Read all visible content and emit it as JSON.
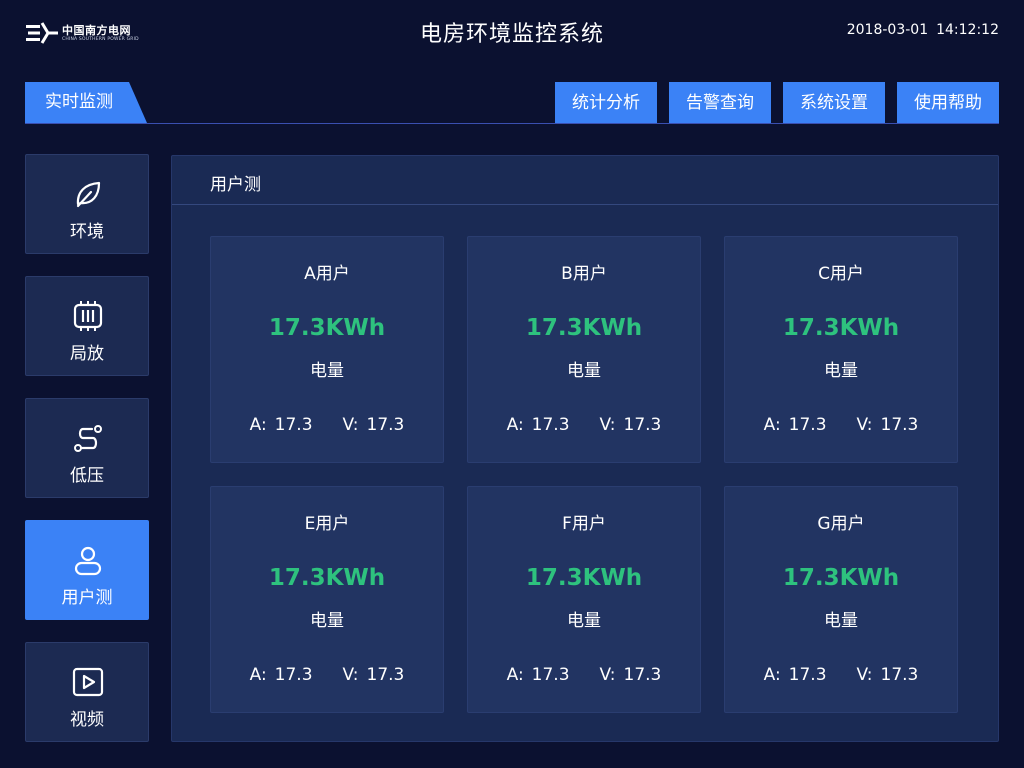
{
  "header": {
    "logo_cn": "中国南方电网",
    "logo_en": "CHINA SOUTHERN POWER GRID",
    "title": "电房环境监控系统",
    "date": "2018-03-01",
    "time": "14:12:12"
  },
  "nav": {
    "active_tab": "实时监测",
    "buttons": [
      "统计分析",
      "告警查询",
      "系统设置",
      "使用帮助"
    ]
  },
  "sidebar": {
    "items": [
      {
        "label": "环境",
        "icon": "leaf-icon",
        "active": false
      },
      {
        "label": "局放",
        "icon": "chip-icon",
        "active": false
      },
      {
        "label": "低压",
        "icon": "route-icon",
        "active": false
      },
      {
        "label": "用户测",
        "icon": "user-icon",
        "active": true
      },
      {
        "label": "视频",
        "icon": "play-icon",
        "active": false
      }
    ]
  },
  "panel": {
    "title": "用户测",
    "cards": [
      {
        "name": "A用户",
        "value": "17.3KWh",
        "value_label": "电量",
        "a_key": "A:",
        "a_val": "17.3",
        "v_key": "V:",
        "v_val": "17.3"
      },
      {
        "name": "B用户",
        "value": "17.3KWh",
        "value_label": "电量",
        "a_key": "A:",
        "a_val": "17.3",
        "v_key": "V:",
        "v_val": "17.3"
      },
      {
        "name": "C用户",
        "value": "17.3KWh",
        "value_label": "电量",
        "a_key": "A:",
        "a_val": "17.3",
        "v_key": "V:",
        "v_val": "17.3"
      },
      {
        "name": "E用户",
        "value": "17.3KWh",
        "value_label": "电量",
        "a_key": "A:",
        "a_val": "17.3",
        "v_key": "V:",
        "v_val": "17.3"
      },
      {
        "name": "F用户",
        "value": "17.3KWh",
        "value_label": "电量",
        "a_key": "A:",
        "a_val": "17.3",
        "v_key": "V:",
        "v_val": "17.3"
      },
      {
        "name": "G用户",
        "value": "17.3KWh",
        "value_label": "电量",
        "a_key": "A:",
        "a_val": "17.3",
        "v_key": "V:",
        "v_val": "17.3"
      }
    ]
  },
  "colors": {
    "background": "#0b1130",
    "accent": "#3b82f6",
    "value_green": "#2ec27e",
    "panel": "#1a2a54",
    "card": "#223462"
  }
}
